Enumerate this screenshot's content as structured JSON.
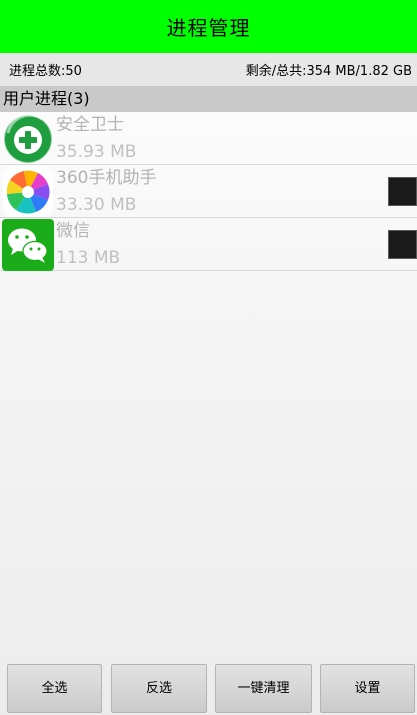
{
  "app": {
    "title": "进程管理",
    "accent_color": "#00ff00"
  },
  "stats": {
    "total_processes": "进程总数:50",
    "memory": "剩余/总共:354 MB/1.82 GB"
  },
  "section": {
    "title": "用户进程(3)"
  },
  "processes": [
    {
      "name": "安全卫士",
      "memory": "35.93 MB",
      "icon": "shield-plus-icon",
      "checkbox_visible": false
    },
    {
      "name": "360手机助手",
      "memory": "33.30 MB",
      "icon": "app-store-icon",
      "checkbox_visible": true
    },
    {
      "name": "微信",
      "memory": "113 MB",
      "icon": "wechat-icon",
      "checkbox_visible": true
    }
  ],
  "buttons": {
    "select_all": "全选",
    "invert": "反选",
    "clean": "一键清理",
    "settings": "设置"
  }
}
